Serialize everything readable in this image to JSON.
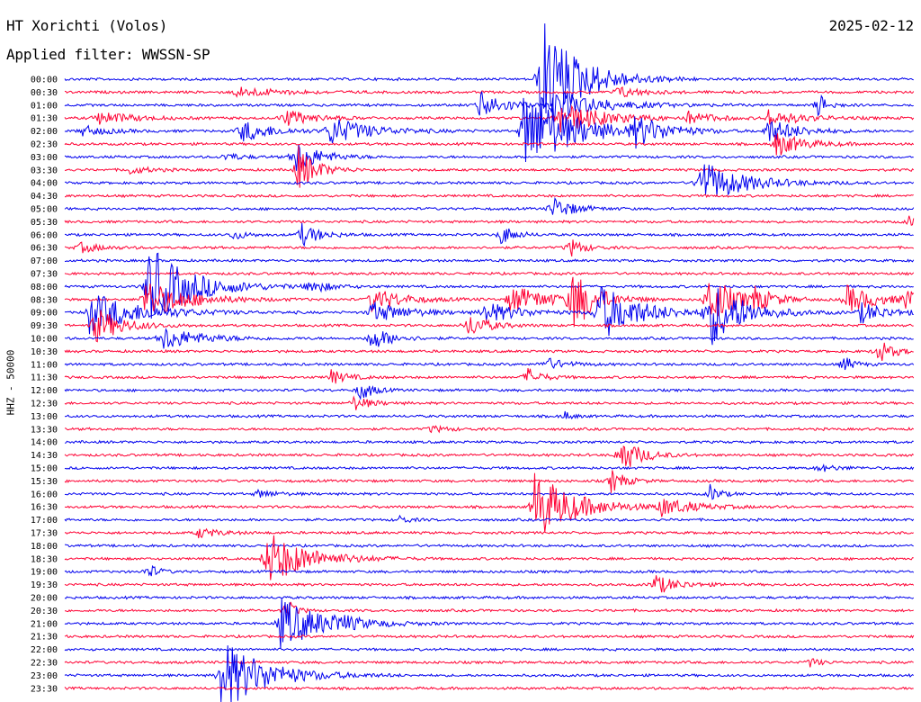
{
  "header": {
    "station": "HT Xorichti (Volos)",
    "filter": "Applied filter: WWSSN-SP",
    "date": "2025-02-12"
  },
  "chart_data": {
    "type": "line",
    "title": "HT Xorichti (Volos)",
    "subtitle": "Applied filter: WWSSN-SP",
    "ylabel": "HHZ - 50000",
    "xlabel": "",
    "row_labels": [
      "00:00",
      "00:30",
      "01:00",
      "01:30",
      "02:00",
      "02:30",
      "03:00",
      "03:30",
      "04:00",
      "04:30",
      "05:00",
      "05:30",
      "06:00",
      "06:30",
      "07:00",
      "07:30",
      "08:00",
      "08:30",
      "09:00",
      "09:30",
      "10:00",
      "10:30",
      "11:00",
      "11:30",
      "12:00",
      "12:30",
      "13:00",
      "13:30",
      "14:00",
      "14:30",
      "15:00",
      "15:30",
      "16:00",
      "16:30",
      "17:00",
      "17:30",
      "18:00",
      "18:30",
      "19:00",
      "19:30",
      "20:00",
      "20:30",
      "21:00",
      "21:30",
      "22:00",
      "22:30",
      "23:00",
      "23:30"
    ],
    "series_colors": [
      "#0000ee",
      "#ff0033"
    ],
    "x_range_minutes": [
      0,
      30
    ],
    "events": [
      {
        "row": 0,
        "minute": 16.8,
        "amp": 72,
        "dur": 2.2
      },
      {
        "row": 1,
        "minute": 6.0,
        "amp": 6,
        "dur": 2.5
      },
      {
        "row": 1,
        "minute": 19.5,
        "amp": 7,
        "dur": 1.4
      },
      {
        "row": 2,
        "minute": 14.6,
        "amp": 16,
        "dur": 1.6
      },
      {
        "row": 2,
        "minute": 17.2,
        "amp": 18,
        "dur": 2.8
      },
      {
        "row": 2,
        "minute": 26.6,
        "amp": 14,
        "dur": 0.6
      },
      {
        "row": 3,
        "minute": 1.1,
        "amp": 8,
        "dur": 2.0
      },
      {
        "row": 3,
        "minute": 7.7,
        "amp": 10,
        "dur": 1.7
      },
      {
        "row": 3,
        "minute": 17.4,
        "amp": 20,
        "dur": 2.5
      },
      {
        "row": 3,
        "minute": 22.0,
        "amp": 7,
        "dur": 1.4
      },
      {
        "row": 3,
        "minute": 24.8,
        "amp": 9,
        "dur": 2.0
      },
      {
        "row": 4,
        "minute": 0.6,
        "amp": 6,
        "dur": 1.5
      },
      {
        "row": 4,
        "minute": 6.2,
        "amp": 13,
        "dur": 1.8
      },
      {
        "row": 4,
        "minute": 9.3,
        "amp": 16,
        "dur": 2.4
      },
      {
        "row": 4,
        "minute": 16.2,
        "amp": 48,
        "dur": 2.8
      },
      {
        "row": 4,
        "minute": 20.1,
        "amp": 16,
        "dur": 1.8
      },
      {
        "row": 4,
        "minute": 24.8,
        "amp": 14,
        "dur": 1.8
      },
      {
        "row": 5,
        "minute": 25.1,
        "amp": 14,
        "dur": 1.6
      },
      {
        "row": 6,
        "minute": 8.1,
        "amp": 20,
        "dur": 1.4
      },
      {
        "row": 6,
        "minute": 5.6,
        "amp": 5,
        "dur": 1.0
      },
      {
        "row": 7,
        "minute": 8.2,
        "amp": 28,
        "dur": 1.1
      },
      {
        "row": 7,
        "minute": 2.2,
        "amp": 5,
        "dur": 1.2
      },
      {
        "row": 8,
        "minute": 22.4,
        "amp": 26,
        "dur": 2.5
      },
      {
        "row": 10,
        "minute": 17.2,
        "amp": 14,
        "dur": 1.2
      },
      {
        "row": 11,
        "minute": 29.8,
        "amp": 6,
        "dur": 0.8
      },
      {
        "row": 12,
        "minute": 5.9,
        "amp": 6,
        "dur": 0.8
      },
      {
        "row": 12,
        "minute": 8.3,
        "amp": 14,
        "dur": 1.1
      },
      {
        "row": 12,
        "minute": 15.4,
        "amp": 12,
        "dur": 0.8
      },
      {
        "row": 13,
        "minute": 0.5,
        "amp": 6,
        "dur": 1.2
      },
      {
        "row": 13,
        "minute": 17.8,
        "amp": 12,
        "dur": 0.8
      },
      {
        "row": 16,
        "minute": 2.9,
        "amp": 48,
        "dur": 2.5
      },
      {
        "row": 16,
        "minute": 8.6,
        "amp": 8,
        "dur": 1.2
      },
      {
        "row": 17,
        "minute": 2.8,
        "amp": 22,
        "dur": 2.5
      },
      {
        "row": 17,
        "minute": 10.8,
        "amp": 14,
        "dur": 1.8
      },
      {
        "row": 17,
        "minute": 15.7,
        "amp": 16,
        "dur": 2.4
      },
      {
        "row": 17,
        "minute": 17.9,
        "amp": 36,
        "dur": 1.3
      },
      {
        "row": 17,
        "minute": 22.7,
        "amp": 32,
        "dur": 1.5
      },
      {
        "row": 17,
        "minute": 24.3,
        "amp": 12,
        "dur": 1.2
      },
      {
        "row": 17,
        "minute": 27.6,
        "amp": 16,
        "dur": 1.8
      },
      {
        "row": 17,
        "minute": 29.7,
        "amp": 12,
        "dur": 0.8
      },
      {
        "row": 18,
        "minute": 0.8,
        "amp": 24,
        "dur": 3.0
      },
      {
        "row": 18,
        "minute": 10.8,
        "amp": 12,
        "dur": 2.2
      },
      {
        "row": 18,
        "minute": 14.8,
        "amp": 12,
        "dur": 2.0
      },
      {
        "row": 18,
        "minute": 18.8,
        "amp": 34,
        "dur": 2.4
      },
      {
        "row": 18,
        "minute": 22.7,
        "amp": 40,
        "dur": 2.0
      },
      {
        "row": 18,
        "minute": 28.1,
        "amp": 12,
        "dur": 1.6
      },
      {
        "row": 19,
        "minute": 14.2,
        "amp": 14,
        "dur": 1.2
      },
      {
        "row": 19,
        "minute": 1.0,
        "amp": 22,
        "dur": 1.6
      },
      {
        "row": 20,
        "minute": 3.4,
        "amp": 14,
        "dur": 2.2
      },
      {
        "row": 20,
        "minute": 10.8,
        "amp": 14,
        "dur": 1.2
      },
      {
        "row": 21,
        "minute": 28.7,
        "amp": 14,
        "dur": 0.9
      },
      {
        "row": 22,
        "minute": 16.9,
        "amp": 8,
        "dur": 1.2
      },
      {
        "row": 22,
        "minute": 27.5,
        "amp": 10,
        "dur": 0.6
      },
      {
        "row": 23,
        "minute": 9.4,
        "amp": 8,
        "dur": 1.0
      },
      {
        "row": 23,
        "minute": 16.3,
        "amp": 12,
        "dur": 0.8
      },
      {
        "row": 24,
        "minute": 10.4,
        "amp": 14,
        "dur": 0.7
      },
      {
        "row": 25,
        "minute": 10.2,
        "amp": 8,
        "dur": 1.0
      },
      {
        "row": 26,
        "minute": 17.6,
        "amp": 6,
        "dur": 0.5
      },
      {
        "row": 27,
        "minute": 12.9,
        "amp": 4,
        "dur": 1.0
      },
      {
        "row": 29,
        "minute": 19.6,
        "amp": 22,
        "dur": 1.2
      },
      {
        "row": 30,
        "minute": 26.6,
        "amp": 4,
        "dur": 1.2
      },
      {
        "row": 31,
        "minute": 19.3,
        "amp": 14,
        "dur": 0.8
      },
      {
        "row": 32,
        "minute": 6.8,
        "amp": 5,
        "dur": 1.0
      },
      {
        "row": 32,
        "minute": 22.8,
        "amp": 10,
        "dur": 0.6
      },
      {
        "row": 33,
        "minute": 16.6,
        "amp": 40,
        "dur": 2.3
      },
      {
        "row": 33,
        "minute": 21.0,
        "amp": 10,
        "dur": 2.0
      },
      {
        "row": 34,
        "minute": 11.8,
        "amp": 5,
        "dur": 0.6
      },
      {
        "row": 35,
        "minute": 4.7,
        "amp": 6,
        "dur": 1.2
      },
      {
        "row": 37,
        "minute": 7.1,
        "amp": 32,
        "dur": 2.4
      },
      {
        "row": 38,
        "minute": 2.9,
        "amp": 10,
        "dur": 0.6
      },
      {
        "row": 39,
        "minute": 20.8,
        "amp": 12,
        "dur": 1.3
      },
      {
        "row": 41,
        "minute": 7.8,
        "amp": 16,
        "dur": 0.5
      },
      {
        "row": 42,
        "minute": 7.6,
        "amp": 30,
        "dur": 2.5
      },
      {
        "row": 42,
        "minute": 9.6,
        "amp": 6,
        "dur": 1.0
      },
      {
        "row": 45,
        "minute": 26.3,
        "amp": 6,
        "dur": 0.6
      },
      {
        "row": 46,
        "minute": 5.5,
        "amp": 42,
        "dur": 2.6
      }
    ]
  }
}
